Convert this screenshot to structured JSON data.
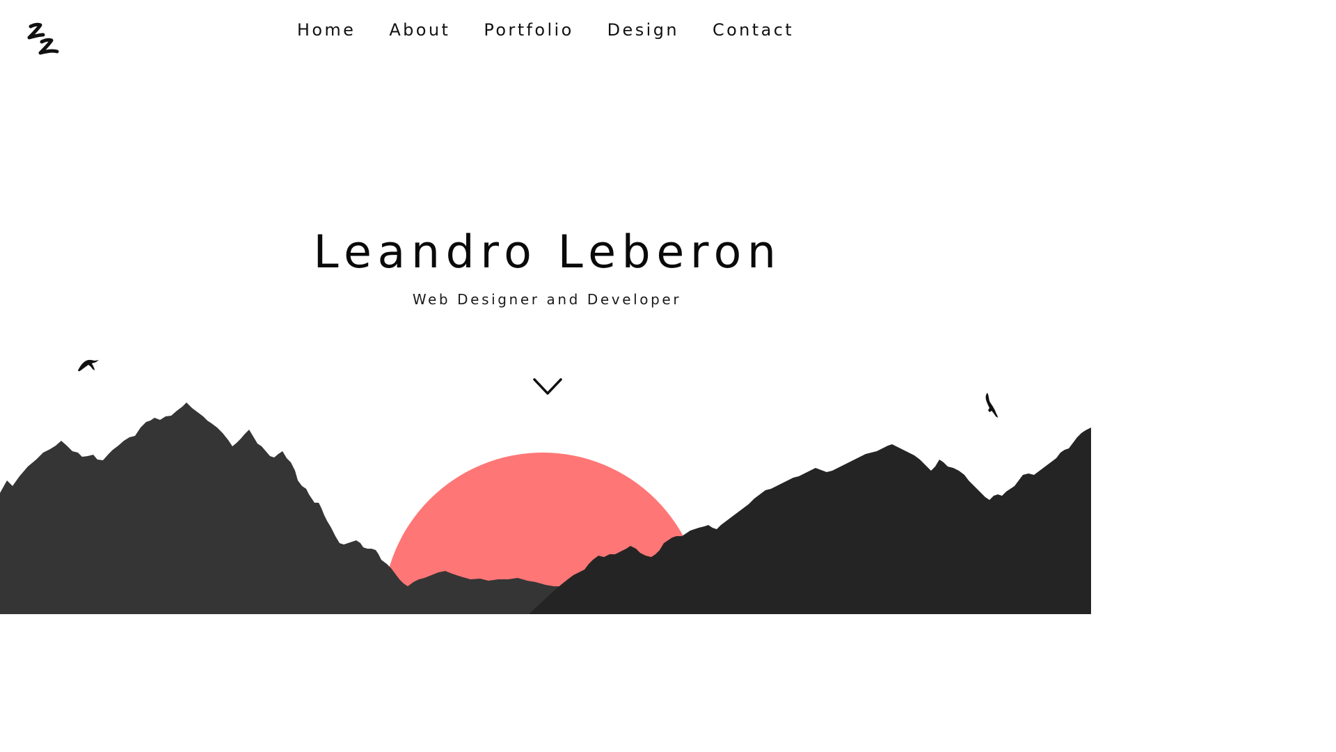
{
  "brand": {
    "logo_icon": "zz-monogram-logo-icon"
  },
  "nav": {
    "items": [
      {
        "label": "Home"
      },
      {
        "label": "About"
      },
      {
        "label": "Portfolio"
      },
      {
        "label": "Design"
      },
      {
        "label": "Contact"
      }
    ]
  },
  "hero": {
    "title": "Leandro Leberon",
    "subtitle": "Web Designer and Developer",
    "scroll_icon": "chevron-down-icon"
  },
  "scene": {
    "sun_color": "#ff7676",
    "mountain_left_color": "#353535",
    "mountain_right_color": "#242424",
    "bird_icons": [
      "bird-icon",
      "eagle-icon"
    ]
  }
}
